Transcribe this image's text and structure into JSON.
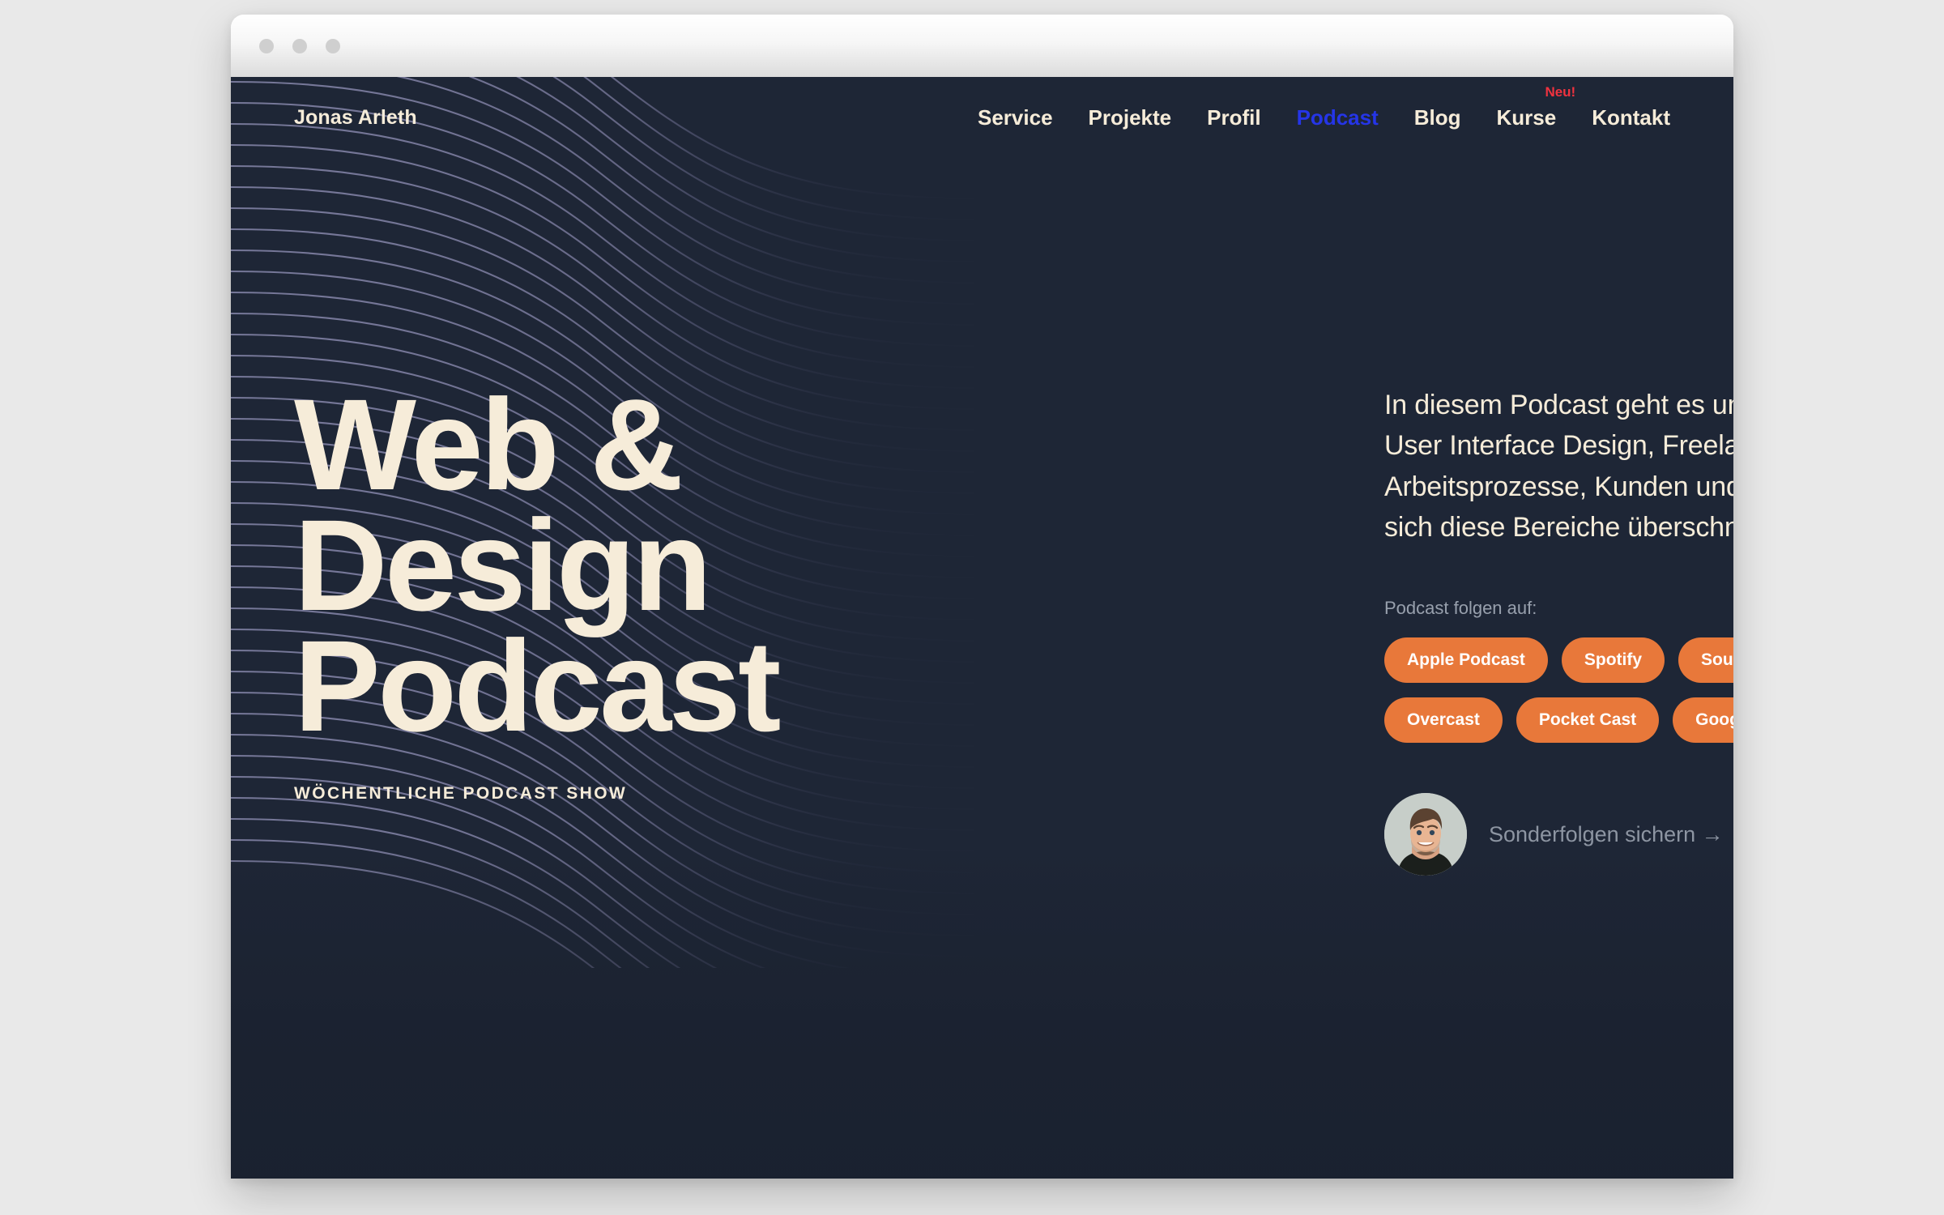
{
  "browser": {
    "traffic_lights": [
      "close",
      "minimize",
      "maximize"
    ]
  },
  "header": {
    "logo": "Jonas Arleth",
    "nav": [
      {
        "label": "Service",
        "active": false,
        "badge": null
      },
      {
        "label": "Projekte",
        "active": false,
        "badge": null
      },
      {
        "label": "Profil",
        "active": false,
        "badge": null
      },
      {
        "label": "Podcast",
        "active": true,
        "badge": null
      },
      {
        "label": "Blog",
        "active": false,
        "badge": null
      },
      {
        "label": "Kurse",
        "active": false,
        "badge": "Neu!"
      },
      {
        "label": "Kontakt",
        "active": false,
        "badge": null
      }
    ]
  },
  "hero": {
    "headline_lines": [
      "Web &",
      "Design",
      "Podcast"
    ],
    "eyebrow": "WÖCHENTLICHE PODCAST SHOW",
    "description": "In diesem Podcast geht es um Web und User Interface Design, Freelancing, Arbeitsprozesse, Kunden und alles, wo sich diese Bereiche überschneiden.",
    "follow_label": "Podcast folgen auf:",
    "platform_buttons_row1": [
      "Apple Podcast",
      "Spotify",
      "Soundcloud"
    ],
    "platform_buttons_row2": [
      "Overcast",
      "Pocket Cast",
      "Google Podcast"
    ],
    "cta_link": "Sonderfolgen sichern →",
    "avatar_alt": "avatar-photo"
  },
  "colors": {
    "page_background": "#1e2636",
    "desktop_background": "#e9e9e9",
    "cream": "#f6ecd9",
    "accent_orange": "#e8783a",
    "accent_blue": "#2535e8",
    "badge_red": "#f0323f",
    "muted_text": "#98a0ad",
    "wave_line": "#6f7090"
  }
}
